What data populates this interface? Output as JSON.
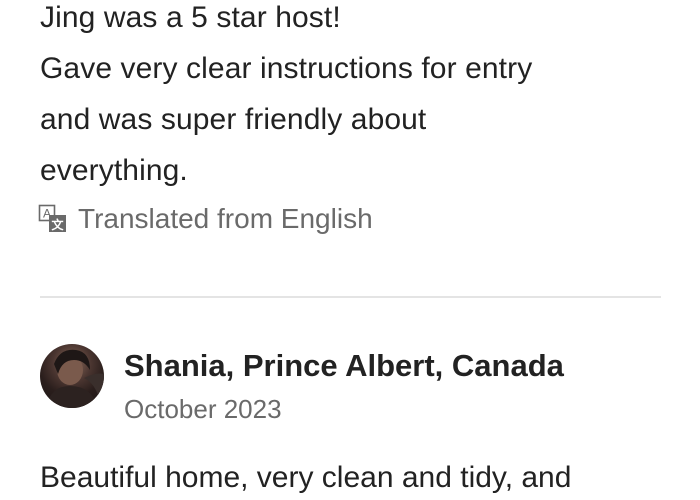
{
  "review_1": {
    "lines": [
      "Jing was a 5 star host!",
      "Gave very clear instructions for entry",
      "and was super friendly about",
      "everything."
    ],
    "translated_label": "Translated from English",
    "translate_icon": "translate-icon"
  },
  "review_2": {
    "reviewer_name": "Shania, Prince Albert, Canada",
    "date": "October 2023",
    "first_line": "Beautiful home, very clean and tidy, and"
  },
  "colors": {
    "text_primary": "#222222",
    "text_secondary": "#6a6a6a",
    "divider": "#e4e4e4"
  }
}
